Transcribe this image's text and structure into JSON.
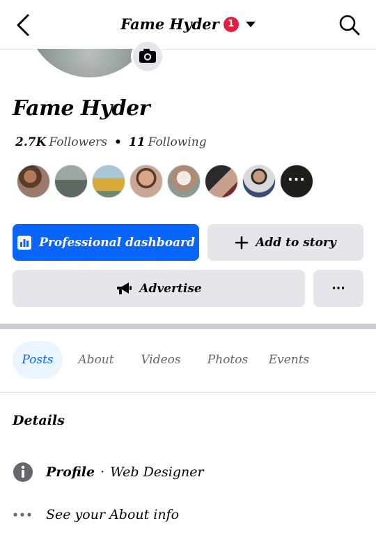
{
  "header": {
    "title": "Fame Hyder",
    "notification_count": "1",
    "icons": [
      "chevron-left-icon",
      "caret-down-icon",
      "search-icon"
    ]
  },
  "profile": {
    "name": "Fame Hyder",
    "followers_count": "2.7K",
    "followers_label": "Followers",
    "following_count": "11",
    "following_label": "Following",
    "friends_more_label": "···"
  },
  "actions": {
    "professional_dashboard": "Professional dashboard",
    "add_to_story": "Add to story",
    "advertise": "Advertise",
    "more": "···"
  },
  "tabs": [
    {
      "label": "Posts",
      "active": true
    },
    {
      "label": "About",
      "active": false
    },
    {
      "label": "Videos",
      "active": false
    },
    {
      "label": "Photos",
      "active": false
    },
    {
      "label": "Events",
      "active": false
    }
  ],
  "details": {
    "title": "Details",
    "profile_label": "Profile",
    "profile_separator": "·",
    "profile_value": "Web Designer",
    "about_info": "See your About info"
  },
  "colors": {
    "accent": "#0866ff",
    "badge": "#e41e3f",
    "button_gray": "#e4e6eb",
    "tab_active_bg": "#ebf5ff"
  }
}
